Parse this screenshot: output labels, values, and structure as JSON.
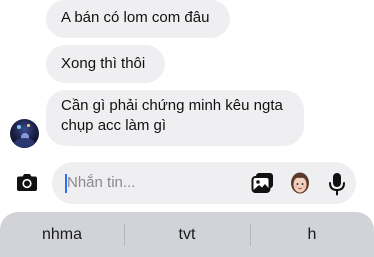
{
  "messages": [
    {
      "text": "A bán có lom com đâu"
    },
    {
      "text": "Xong thì thôi"
    },
    {
      "lines": [
        "Cần gì phải chứng minh kêu ngta",
        "chụp acc làm gì"
      ]
    }
  ],
  "composer": {
    "placeholder": "Nhắn tin...",
    "icons": [
      "camera-icon",
      "gallery-icon",
      "sticker-icon",
      "microphone-icon"
    ]
  },
  "keyboard_suggestions": [
    "nhma",
    "tvt",
    "h"
  ],
  "colors": {
    "bubble": "#efeff1",
    "input": "#efeff1",
    "suggestion_bar": "#d1d3d9",
    "caret": "#2f6bff"
  }
}
